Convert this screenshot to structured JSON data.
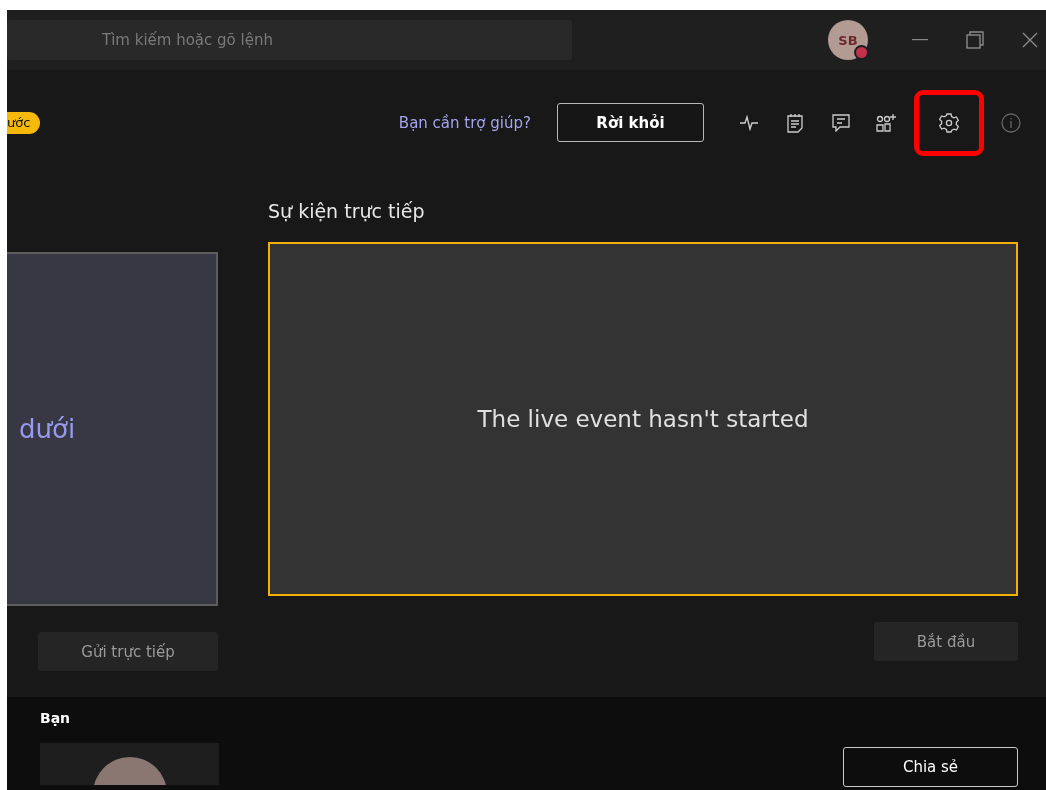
{
  "title_bar": {
    "search": {
      "placeholder": "Tìm kiếm hoặc gõ lệnh"
    },
    "avatar": {
      "initials": "SB",
      "busy": true
    }
  },
  "header": {
    "badge": "ước",
    "help_link": "Bạn cần trợ giúp?",
    "leave_button": "Rời khỏi",
    "tools": [
      {
        "kind": "health",
        "highlighted": false
      },
      {
        "kind": "notes",
        "highlighted": false
      },
      {
        "kind": "chat",
        "highlighted": false
      },
      {
        "kind": "people",
        "highlighted": false
      },
      {
        "kind": "settings",
        "highlighted": true
      },
      {
        "kind": "info",
        "highlighted": false
      }
    ]
  },
  "queue_preview": {
    "text": "dưới",
    "button": "Gửi trực tiếp"
  },
  "live_event": {
    "title": "Sự kiện trực tiếp",
    "message": "The live event hasn't started",
    "button": "Bắt đầu"
  },
  "presenter": {
    "label": "Bạn",
    "share_button": "Chia sẻ"
  }
}
